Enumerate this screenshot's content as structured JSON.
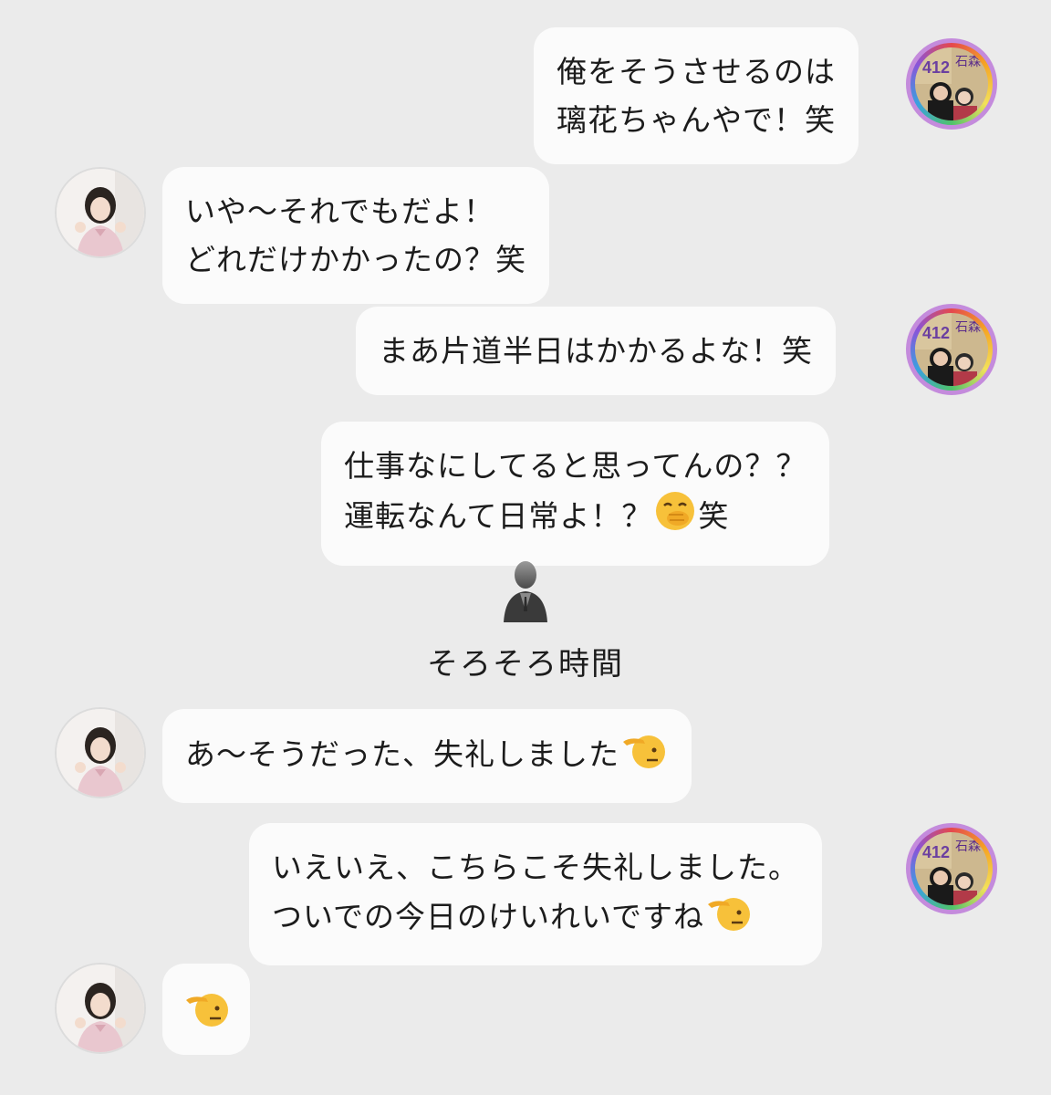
{
  "messages": [
    {
      "sender": "user",
      "lines": [
        "俺をそうさせるのは",
        "璃花ちゃんやで！笑"
      ]
    },
    {
      "sender": "idol",
      "lines": [
        "いや〜それでもだよ！",
        "どれだけかかったの？笑"
      ]
    },
    {
      "sender": "user",
      "lines": [
        "まあ片道半日はかかるよな！笑"
      ]
    },
    {
      "sender": "user",
      "lines": [
        "仕事なにしてると思ってんの？？",
        "運転なんて日常よ！？",
        "笑"
      ],
      "emoji": "hand-over-mouth-emoji"
    },
    {
      "sender": "idol",
      "lines": [
        "あ〜そうだった、失礼しました"
      ],
      "emoji": "saluting-face-emoji"
    },
    {
      "sender": "user",
      "lines": [
        "いえいえ、こちらこそ失礼しました。",
        "ついでの今日のけいれいですね"
      ],
      "emoji": "saluting-face-emoji"
    },
    {
      "sender": "idol",
      "lines": [],
      "emoji": "saluting-face-emoji"
    }
  ],
  "system_notice": {
    "icon": "person-silhouette-icon",
    "text": "そろそろ時間"
  },
  "avatar_user_text": {
    "title": "石森",
    "number": "412"
  },
  "colors": {
    "background": "#ebebeb",
    "bubble": "#fbfbfb",
    "text": "#1c1c1c",
    "user_avatar_ring": "#c48bdc"
  }
}
